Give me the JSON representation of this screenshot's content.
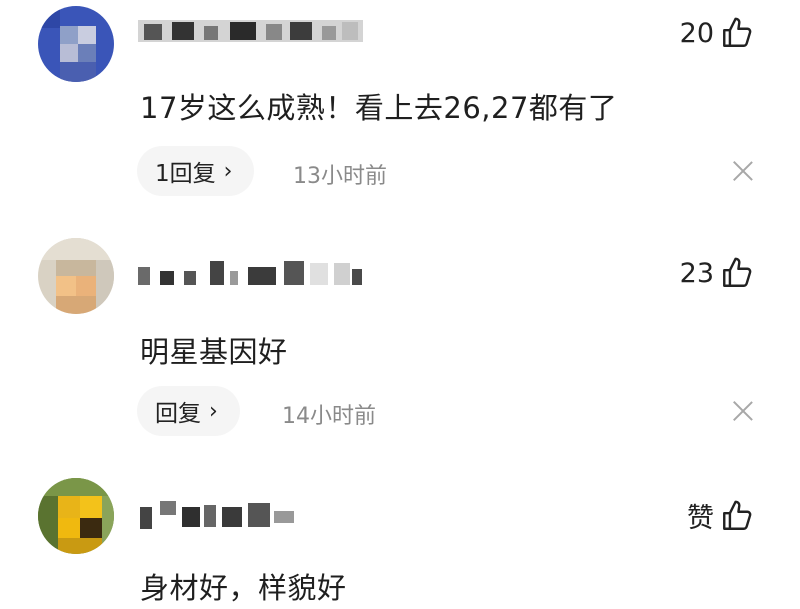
{
  "comments": [
    {
      "like": {
        "count": "20"
      },
      "text": "17岁这么成熟！看上去26,27都有了",
      "reply_label": "1回复",
      "time": "13小时前"
    },
    {
      "like": {
        "count": "23"
      },
      "text": "明星基因好",
      "reply_label": "回复",
      "time": "14小时前"
    },
    {
      "like": {
        "count": "赞"
      },
      "text": "身材好，样貌好"
    }
  ],
  "icons": {
    "like": "thumbs-up-icon",
    "dismiss": "close-icon",
    "reply_arrow": "chevron-right-icon"
  },
  "colors": {
    "text": "#1f1f1f",
    "secondary": "#8a8a8a",
    "pill_bg": "#f5f5f5"
  }
}
